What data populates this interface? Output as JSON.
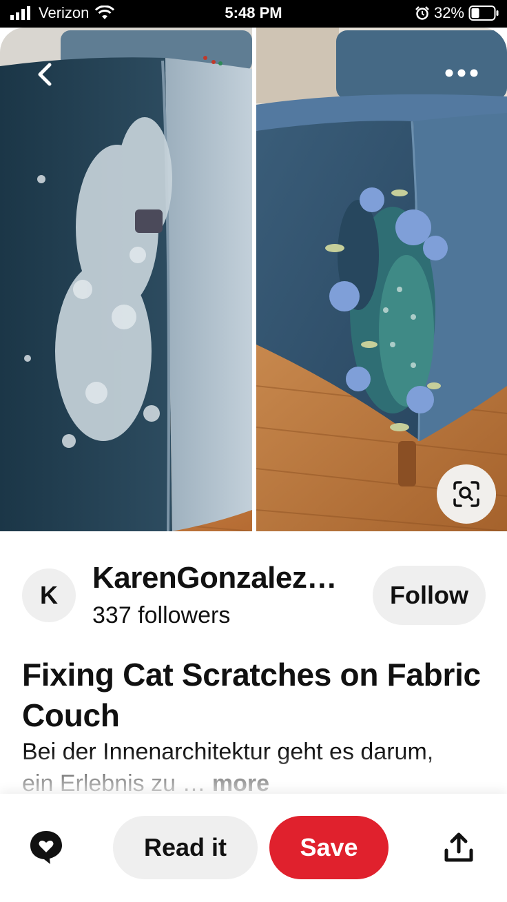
{
  "status_bar": {
    "carrier": "Verizon",
    "time": "5:48 PM",
    "battery": "32%",
    "icons": [
      "signal-icon",
      "wifi-icon",
      "alarm-icon",
      "battery-icon"
    ]
  },
  "pin": {
    "image_icons": [
      "back-icon",
      "more-icon",
      "visual-search-icon"
    ],
    "creator": {
      "initial": "K",
      "name": "KarenGonzalez…",
      "followers": "337 followers",
      "follow_label": "Follow"
    },
    "title": "Fixing Cat Scratches on Fabric Couch",
    "description": "Bei der Innenarchitektur geht es darum, ein Erlebnis zu …",
    "more_label": "more"
  },
  "action_bar": {
    "read_label": "Read it",
    "save_label": "Save",
    "icons": [
      "comment-icon",
      "share-icon"
    ]
  },
  "colors": {
    "save": "#e0212d",
    "pill": "#efefef",
    "text": "#111111"
  }
}
